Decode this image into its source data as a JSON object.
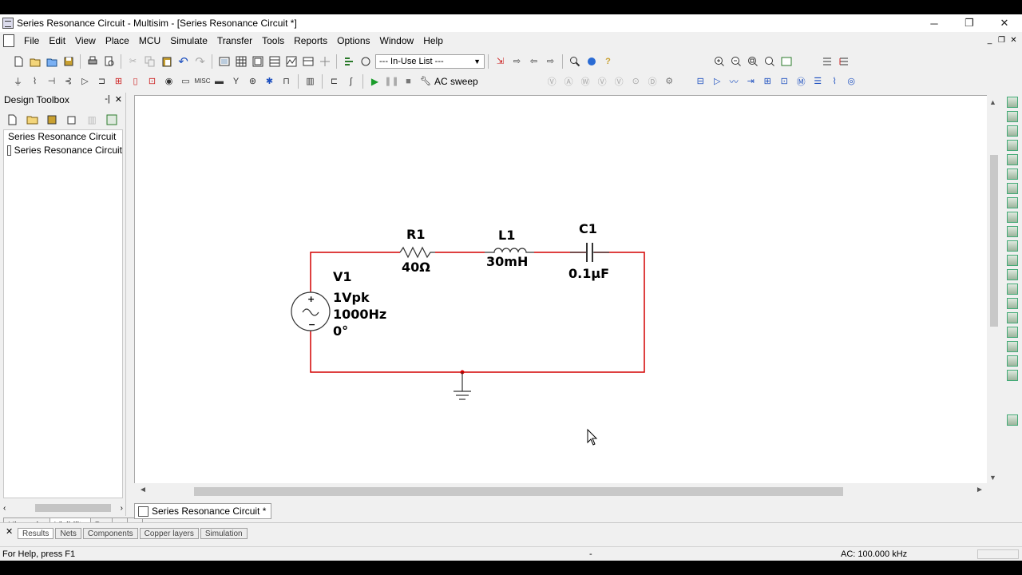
{
  "window": {
    "title": "Series Resonance Circuit - Multisim - [Series Resonance Circuit *]",
    "minimize": "─",
    "restore": "❐",
    "close": "✕"
  },
  "menu": [
    "File",
    "Edit",
    "View",
    "Place",
    "MCU",
    "Simulate",
    "Transfer",
    "Tools",
    "Reports",
    "Options",
    "Window",
    "Help"
  ],
  "mdi": {
    "minimize": "_",
    "restore": "❐",
    "close": "✕"
  },
  "toolbar": {
    "in_use_list": "--- In-Use List ---",
    "simulation_analysis": "AC sweep"
  },
  "design_toolbox": {
    "title": "Design Toolbox",
    "pin": "-|",
    "close": "✕",
    "tree_root": "Series Resonance Circuit",
    "tree_child": "Series Resonance Circuit",
    "tabs": [
      "Hierarchy",
      "Visibility",
      "Prc"
    ]
  },
  "document_tab": "Series Resonance Circuit *",
  "circuit": {
    "wire_color": "#d40000",
    "source": {
      "ref": "V1",
      "amplitude": "1Vpk",
      "frequency": "1000Hz",
      "phase": "0°"
    },
    "resistor": {
      "ref": "R1",
      "value": "40Ω"
    },
    "inductor": {
      "ref": "L1",
      "value": "30mH"
    },
    "capacitor": {
      "ref": "C1",
      "value": "0.1µF"
    }
  },
  "spreadsheet_tabs": [
    "Results",
    "Nets",
    "Components",
    "Copper layers",
    "Simulation"
  ],
  "status": {
    "help": "For Help, press F1",
    "middle": "-",
    "analysis": "AC: 100.000 kHz"
  }
}
